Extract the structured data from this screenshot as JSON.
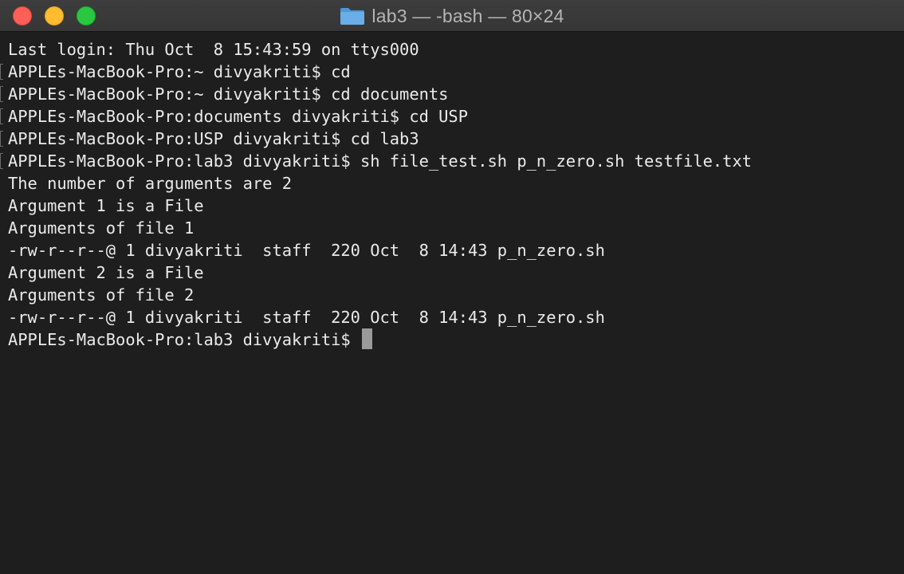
{
  "window": {
    "title": "lab3 — -bash — 80×24",
    "folder_color": "#6aaee8"
  },
  "terminal": {
    "lines": [
      "Last login: Thu Oct  8 15:43:59 on ttys000",
      "APPLEs-MacBook-Pro:~ divyakriti$ cd",
      "APPLEs-MacBook-Pro:~ divyakriti$ cd documents",
      "APPLEs-MacBook-Pro:documents divyakriti$ cd USP",
      "APPLEs-MacBook-Pro:USP divyakriti$ cd lab3",
      "APPLEs-MacBook-Pro:lab3 divyakriti$ sh file_test.sh p_n_zero.sh testfile.txt",
      "The number of arguments are 2",
      "Argument 1 is a File",
      "Arguments of file 1",
      "-rw-r--r--@ 1 divyakriti  staff  220 Oct  8 14:43 p_n_zero.sh",
      "Argument 2 is a File",
      "Arguments of file 2",
      "-rw-r--r--@ 1 divyakriti  staff  220 Oct  8 14:43 p_n_zero.sh",
      "APPLEs-MacBook-Pro:lab3 divyakriti$ "
    ]
  }
}
